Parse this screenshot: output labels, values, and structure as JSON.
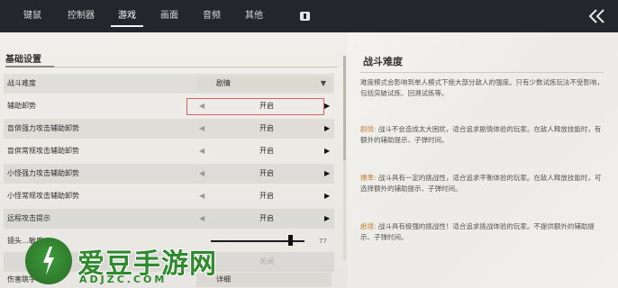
{
  "tabs": [
    {
      "label": "键鼠"
    },
    {
      "label": "控制器"
    },
    {
      "label": "游戏"
    },
    {
      "label": "画面"
    },
    {
      "label": "音频"
    },
    {
      "label": "其他"
    }
  ],
  "active_tab": "游戏",
  "section_title": "基础设置",
  "rows": [
    {
      "label": "战斗难度",
      "value": "剧情"
    },
    {
      "label": "辅助卸势",
      "value": "开启"
    },
    {
      "label": "盲傧强力攻击辅助卸势",
      "value": "开启"
    },
    {
      "label": "盲傧常规攻击辅助卸势",
      "value": "开启"
    },
    {
      "label": "小怪强力攻击辅助卸势",
      "value": "开启"
    },
    {
      "label": "小怪常规攻击辅助卸势",
      "value": "开启"
    },
    {
      "label": "远程攻击提示",
      "value": "开启"
    },
    {
      "label": "镜头…敏度",
      "value": "77"
    },
    {
      "label": "",
      "value": "关闭"
    },
    {
      "label": "伤害跳字",
      "value": "详细"
    }
  ],
  "slider": {
    "level": 0.85
  },
  "detail": {
    "title": "战斗难度",
    "intro": "难度模式会影响到单人模式下绝大部分敌人的强度。只有少数试炼玩法不受影响，包括突破试炼、回溯试炼等。",
    "modes": [
      {
        "name": "剧情:",
        "desc": "战斗不会造成太大困扰，适合追求剧情体验的玩家。在敌人释放技能时，有额外的辅助提示、子弹时间。"
      },
      {
        "name": "標準:",
        "desc": "战斗具有一定的挑战性，适合追求平衡体验的玩家。在敌人释放技能时，可选择额外的辅助提示、子弹时间。"
      },
      {
        "name": "絶境:",
        "desc": "战斗具有极强的挑战性！适合追求挑战体验的玩家。不提供额外的辅助提示、子弹时间。"
      }
    ]
  },
  "watermark": {
    "text_cn": "爱豆手游网",
    "text_en": "ADJZC.COM"
  },
  "colors": {
    "highlight": "#c5803c",
    "topbar": "#24262b",
    "watermark": "#2f8a2d"
  }
}
